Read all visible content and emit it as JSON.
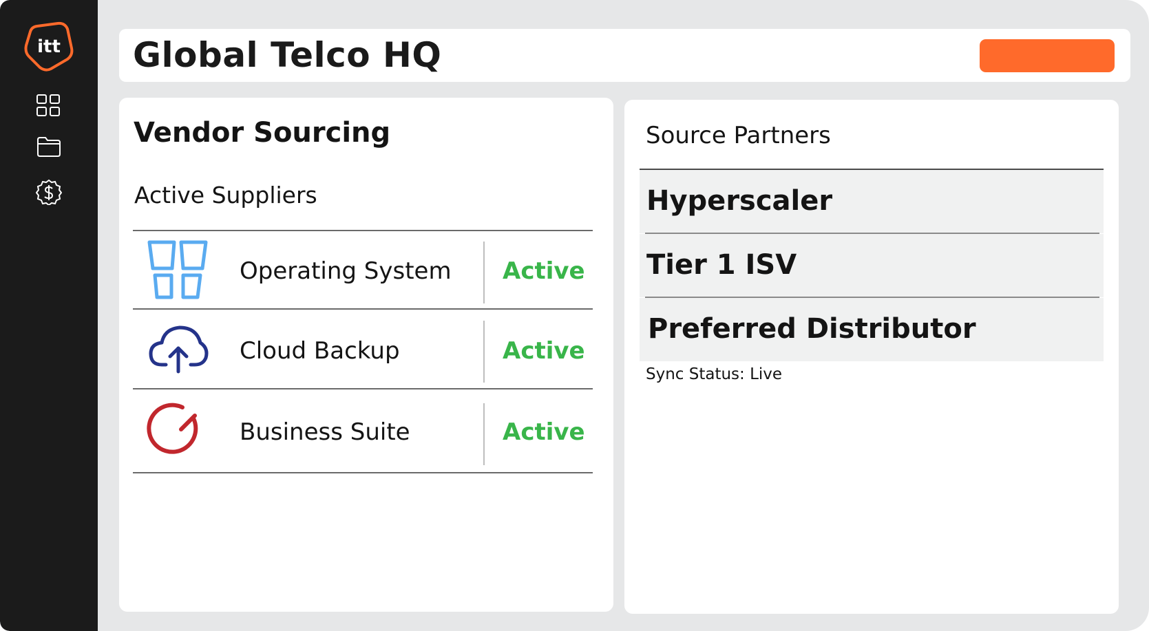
{
  "app": {
    "logo_text": "itt",
    "brand_color": "#ff6a2b"
  },
  "sidebar": {
    "items": [
      {
        "name": "dashboard",
        "icon": "grid-icon"
      },
      {
        "name": "files",
        "icon": "folder-icon"
      },
      {
        "name": "finance",
        "icon": "dollar-badge-icon"
      }
    ]
  },
  "header": {
    "title": "Global Telco HQ",
    "action_button_label": ""
  },
  "vendor_sourcing": {
    "title": "Vendor Sourcing",
    "subtitle": "Active Suppliers",
    "suppliers": [
      {
        "name": "Operating System",
        "status": "Active",
        "icon": "windows-icon"
      },
      {
        "name": "Cloud Backup",
        "status": "Active",
        "icon": "cloud-upload-icon"
      },
      {
        "name": "Business Suite",
        "status": "Active",
        "icon": "power-dial-icon"
      }
    ],
    "status_color": "#39b54a"
  },
  "source_partners": {
    "title": "Source Partners",
    "partners": [
      "Hyperscaler",
      "Tier 1 ISV",
      "Preferred Distributor"
    ],
    "sync_status": "Sync Status: Live"
  }
}
